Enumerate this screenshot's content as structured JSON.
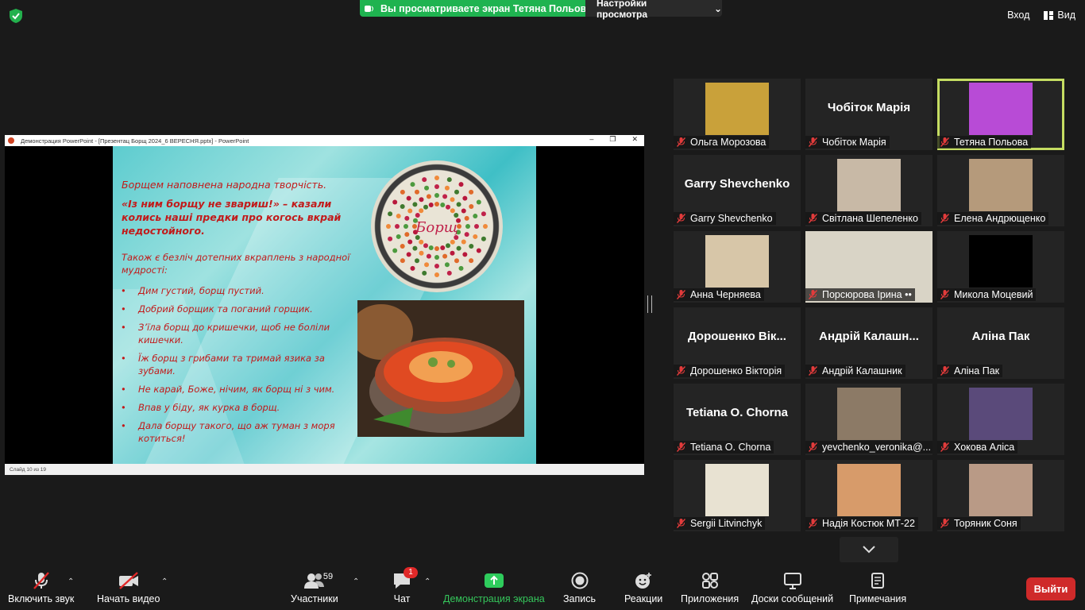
{
  "top": {
    "share_notice": "Вы просматриваете экран Тетяна Польова",
    "view_options": "Настройки просмотра",
    "exit": "Вход",
    "view": "Вид"
  },
  "ppt": {
    "window_title": "Демонстрация PowerPoint - [Презентац Борщ 2024_6 ВЕРЕСНЯ.pptx] - PowerPoint",
    "status": "Слайд 10 из 19",
    "slide": {
      "line1": "Борщем наповнена народна творчість.",
      "quote": "«Із ним борщу не звариш!» – казали колись наші предки про когось вкрай недостойного.",
      "intro": "Також є безліч дотепних вкраплень з народної мудрості:",
      "bullets": [
        "Дим густий, борщ пустий.",
        "Добрий борщик та поганий горщик.",
        "З’їла борщ до кришечки, щоб не боліли кишечки.",
        "Їж борщ з грибами та тримай язика за зубами.",
        "Не карай, Боже, нічим, як борщ ні з чим.",
        "Впав у біду, як курка в борщ.",
        "Дала борщу такого, що аж туман з моря котиться!"
      ],
      "hoop_text": "Борщ"
    }
  },
  "gallery": [
    {
      "name": "Ольга Морозова",
      "big": "",
      "pic": "#c9a13a"
    },
    {
      "name": "Чобіток Марія",
      "big": "Чобіток Марія",
      "pic": ""
    },
    {
      "name": "Тетяна Польова",
      "big": "",
      "pic": "#b84bd6"
    },
    {
      "name": "Garry Shevchenko",
      "big": "Garry Shevchenko",
      "pic": ""
    },
    {
      "name": "Світлана Шепеленко",
      "big": "",
      "pic": "#c8b9a6"
    },
    {
      "name": "Елена Андрющенко",
      "big": "",
      "pic": "#b59a7b"
    },
    {
      "name": "Анна Черняева",
      "big": "",
      "pic": "#d7c6a8"
    },
    {
      "name": "Порсюрова Ірина ••",
      "big": "",
      "pic": "#d9d4c6"
    },
    {
      "name": "Микола Моцевий",
      "big": "",
      "pic": "#000000"
    },
    {
      "name": "Дорошенко Вікторія",
      "big": "Дорошенко Вік...",
      "pic": ""
    },
    {
      "name": "Андрій Калашник",
      "big": "Андрій Калашн...",
      "pic": ""
    },
    {
      "name": "Аліна Пак",
      "big": "Аліна Пак",
      "pic": ""
    },
    {
      "name": "Tetiana O. Chorna",
      "big": "Tetiana O. Chorna",
      "pic": ""
    },
    {
      "name": "yevchenko_veronika@...",
      "big": "",
      "pic": "#8c7a66"
    },
    {
      "name": "Хокова Аліса",
      "big": "",
      "pic": "#5a4a7a"
    },
    {
      "name": "Sergii Litvinchyk",
      "big": "",
      "pic": "#e8e2d2"
    },
    {
      "name": "Надія Костюк МТ-22",
      "big": "",
      "pic": "#d79b6a"
    },
    {
      "name": "Торяник Соня",
      "big": "",
      "pic": "#b99a86"
    }
  ],
  "toolbar": {
    "unmute": "Включить звук",
    "start_video": "Начать видео",
    "participants": "Участники",
    "participants_count": "59",
    "chat": "Чат",
    "chat_badge": "1",
    "share": "Демонстрация экрана",
    "record": "Запись",
    "reactions": "Реакции",
    "apps": "Приложения",
    "whiteboards": "Доски сообщений",
    "notes": "Примечания",
    "leave": "Выйти"
  },
  "colors": {
    "accent_green": "#1fb350",
    "leave_red": "#cf2a2a",
    "active_speaker": "#c5dd62"
  }
}
